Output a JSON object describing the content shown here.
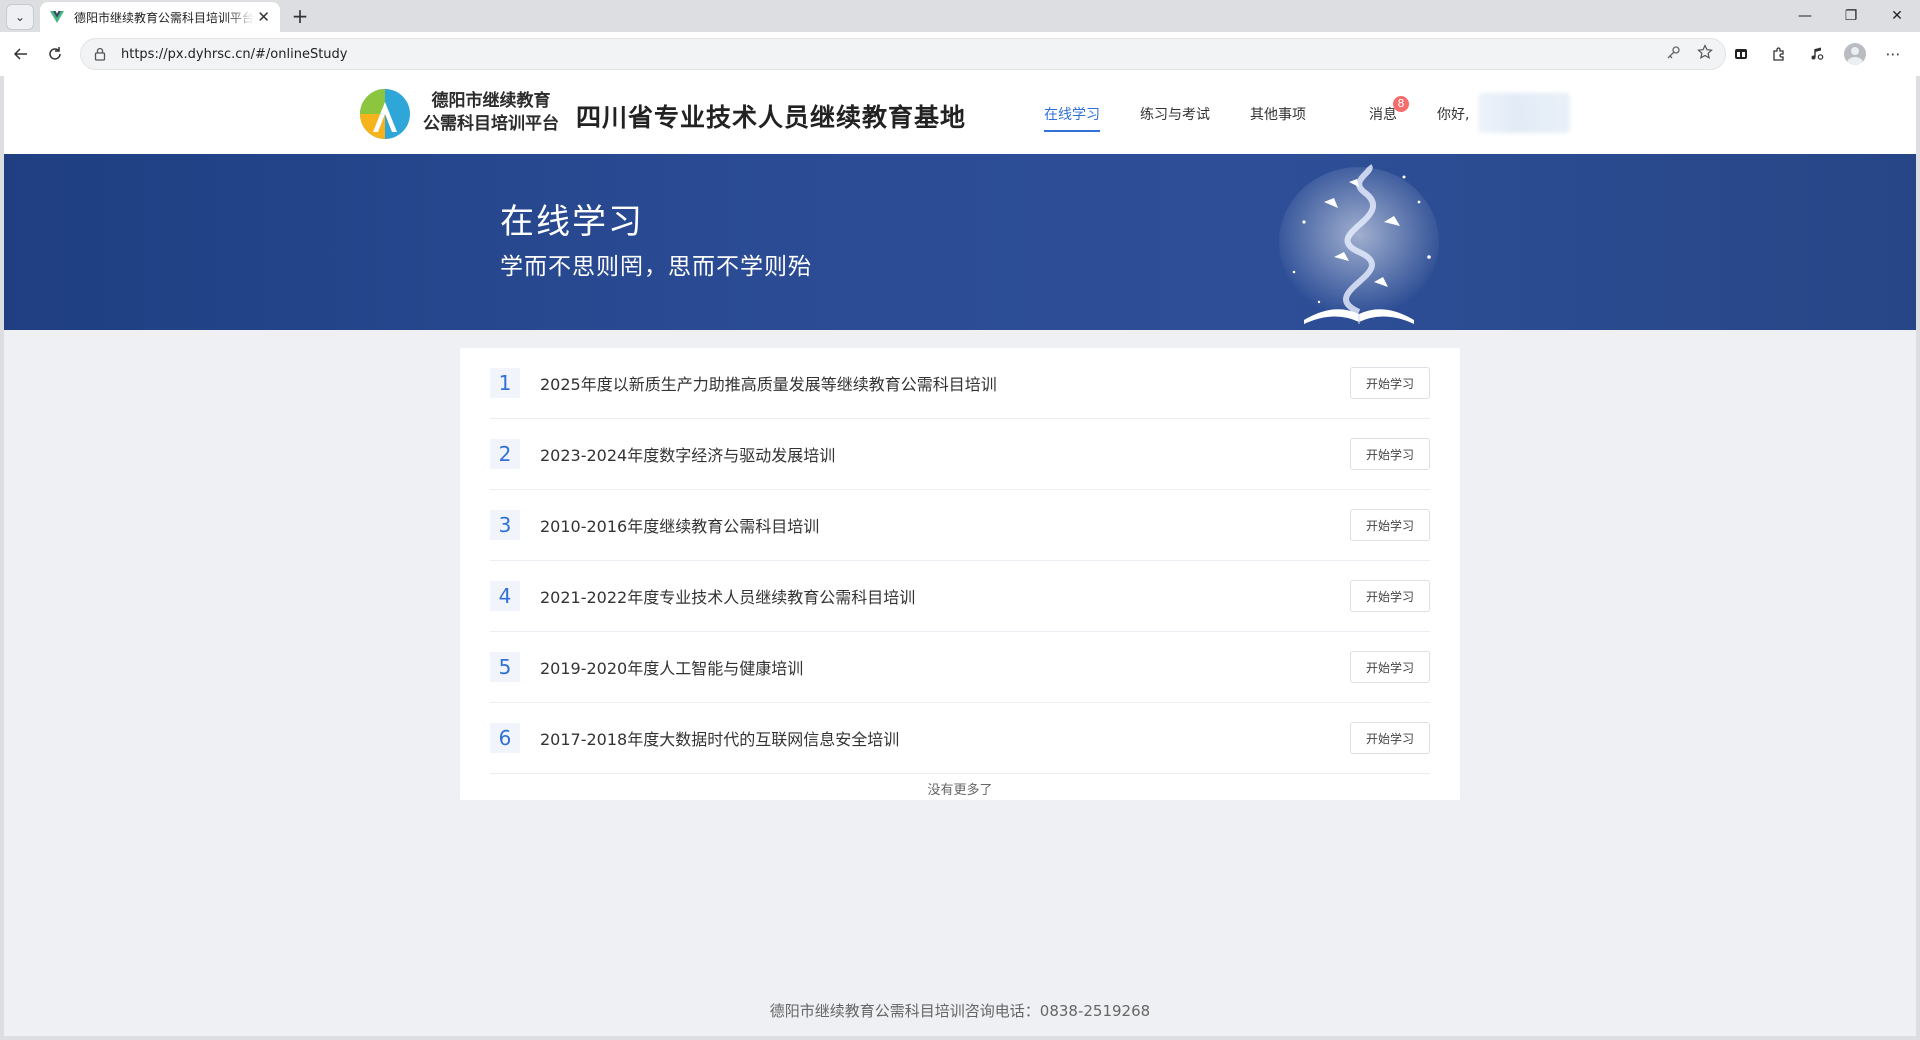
{
  "browser": {
    "tab_title": "德阳市继续教育公需科目培训平台",
    "url": "https://px.dyhrsc.cn/#/onlineStudy",
    "tab_close": "✕",
    "new_tab": "+",
    "win_minimize": "—",
    "win_restore": "❐",
    "win_close": "✕"
  },
  "header": {
    "logo_line1": "德阳市继续教育",
    "logo_line2": "公需科目培训平台",
    "site_title": "四川省专业技术人员继续教育基地",
    "nav": [
      {
        "label": "在线学习",
        "active": true
      },
      {
        "label": "练习与考试",
        "active": false
      },
      {
        "label": "其他事项",
        "active": false
      }
    ],
    "messages_label": "消息",
    "messages_count": "8",
    "greeting": "你好,"
  },
  "banner": {
    "title": "在线学习",
    "subtitle": "学而不思则罔，思而不学则殆"
  },
  "courses": [
    {
      "index": "1",
      "name": "2025年度以新质生产力助推高质量发展等继续教育公需科目培训",
      "action": "开始学习"
    },
    {
      "index": "2",
      "name": "2023-2024年度数字经济与驱动发展培训",
      "action": "开始学习"
    },
    {
      "index": "3",
      "name": "2010-2016年度继续教育公需科目培训",
      "action": "开始学习"
    },
    {
      "index": "4",
      "name": "2021-2022年度专业技术人员继续教育公需科目培训",
      "action": "开始学习"
    },
    {
      "index": "5",
      "name": "2019-2020年度人工智能与健康培训",
      "action": "开始学习"
    },
    {
      "index": "6",
      "name": "2017-2018年度大数据时代的互联网信息安全培训",
      "action": "开始学习"
    }
  ],
  "list_end_text": "没有更多了",
  "footer_text": "德阳市继续教育公需科目培训咨询电话：0838-2519268",
  "colors": {
    "accent": "#2f71d6",
    "banner": "#2b4c95",
    "badge": "#f56c6c"
  }
}
